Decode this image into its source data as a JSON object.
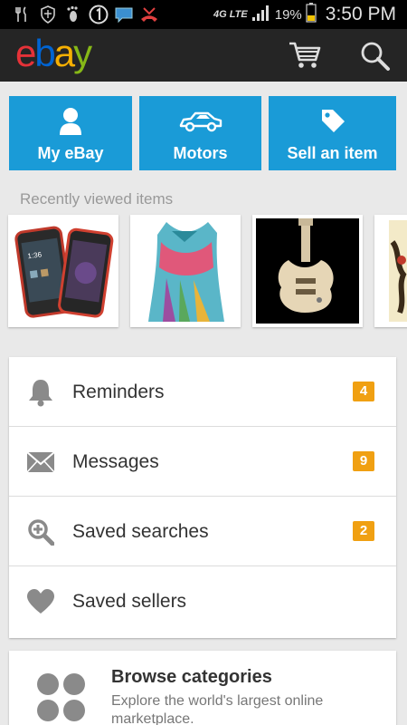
{
  "status_bar": {
    "icons": [
      "fork-knife-icon",
      "shield-icon",
      "footprint-icon",
      "number-1-icon",
      "chat-bubble-icon",
      "missed-call-icon"
    ],
    "network": "4G LTE",
    "battery": "19%",
    "time": "3:50 PM"
  },
  "app_bar": {
    "logo_letters": [
      "e",
      "b",
      "a",
      "y"
    ],
    "logo_colors": [
      "#e53238",
      "#0064d2",
      "#f5af02",
      "#86b817"
    ]
  },
  "tiles": [
    {
      "label": "My eBay",
      "icon": "person-icon"
    },
    {
      "label": "Motors",
      "icon": "car-icon"
    },
    {
      "label": "Sell an item",
      "icon": "price-tag-icon"
    }
  ],
  "recently_viewed": {
    "title": "Recently viewed items",
    "items": [
      "smartphone-thumbnail",
      "scarf-thumbnail",
      "guitar-thumbnail",
      "partial-thumbnail"
    ]
  },
  "list": [
    {
      "label": "Reminders",
      "icon": "bell-icon",
      "badge": "4"
    },
    {
      "label": "Messages",
      "icon": "envelope-icon",
      "badge": "9"
    },
    {
      "label": "Saved searches",
      "icon": "search-plus-icon",
      "badge": "2"
    },
    {
      "label": "Saved sellers",
      "icon": "heart-icon",
      "badge": ""
    }
  ],
  "browse": {
    "title": "Browse categories",
    "subtitle": "Explore the world's largest online marketplace."
  },
  "colors": {
    "tile_blue": "#1a9bd7",
    "badge_orange": "#f0a012",
    "background": "#e9e9e9",
    "app_bar": "#252525"
  }
}
